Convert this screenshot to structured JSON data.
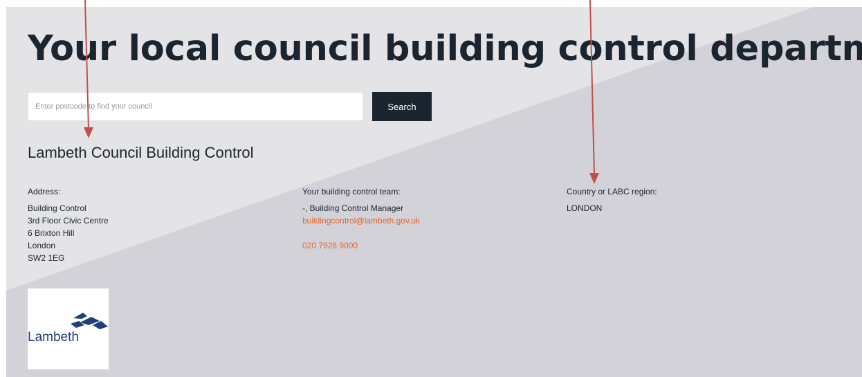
{
  "page": {
    "title": "Your local council building control department"
  },
  "search": {
    "placeholder": "Enter postcode to find your council",
    "button_label": "Search"
  },
  "council": {
    "name": "Lambeth Council Building Control",
    "address": {
      "label": "Address:",
      "lines": [
        "Building Control",
        "3rd Floor Civic Centre",
        "6 Brixton Hill",
        "London",
        "SW2 1EG"
      ]
    },
    "team": {
      "label": "Your building control team:",
      "contact": "-, Building Control Manager",
      "email": "buildingcontrol@lambeth.gov.uk",
      "phone": "020 7926 9000"
    },
    "region": {
      "label": "Country or LABC region:",
      "value": "LONDON"
    },
    "logo_text": "Lambeth"
  },
  "colors": {
    "heading": "#1b2530",
    "link": "#e1662a",
    "background_light": "#e4e4e7",
    "background_dark": "#d3d2d8",
    "annotation_arrow": "#c0504d",
    "logo_blue": "#1f3e7a"
  }
}
